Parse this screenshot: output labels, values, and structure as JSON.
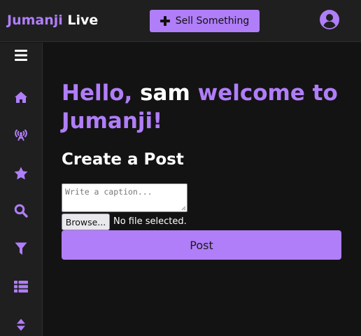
{
  "header": {
    "brand_part1": "Jumanji",
    "brand_part2": "Live",
    "sell_label": "Sell Something",
    "user_icon": "user-circle-icon"
  },
  "sidebar": {
    "items": [
      {
        "icon": "menu-icon"
      },
      {
        "icon": "home-icon"
      },
      {
        "icon": "broadcast-tower-icon"
      },
      {
        "icon": "star-icon"
      },
      {
        "icon": "search-icon"
      },
      {
        "icon": "filter-icon"
      },
      {
        "icon": "list-icon"
      },
      {
        "icon": "sort-icon"
      }
    ]
  },
  "main": {
    "greeting_pre": "Hello,",
    "username": "sam",
    "greeting_post": "welcome to Jumanji!",
    "post_heading": "Create a Post",
    "caption_placeholder": "Write a caption...",
    "browse_label": "Browse...",
    "file_status": "No file selected.",
    "post_label": "Post"
  },
  "colors": {
    "accent": "#b07ef8",
    "background": "#141314",
    "panel": "#1f1f20"
  }
}
